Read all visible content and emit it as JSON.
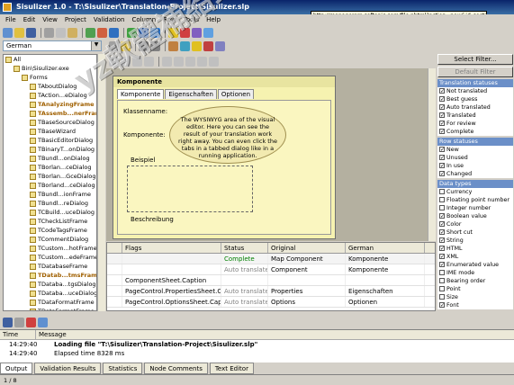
{
  "window": {
    "title": "Sisulizer 1.0 - T:\\Sisulizer\\Translation-Project\\Sisulizer.slp"
  },
  "tooltip": {
    "text": "http://managerem.softonic.com/file.phtml?action=new&id_section=724"
  },
  "menu": [
    "File",
    "Edit",
    "View",
    "Project",
    "Validation",
    "Column",
    "Row",
    "Tools",
    "Help"
  ],
  "language": {
    "selected": "German"
  },
  "tree": {
    "items": [
      {
        "label": "All",
        "bold": false,
        "level": 0
      },
      {
        "label": "Bin\\Sisulizer.exe",
        "bold": false,
        "level": 1
      },
      {
        "label": "Forms",
        "bold": false,
        "level": 2
      },
      {
        "label": "TAboutDialog",
        "bold": false,
        "level": 3
      },
      {
        "label": "TAction...eDialog",
        "bold": false,
        "level": 3
      },
      {
        "label": "TAnalyzingFrame",
        "bold": true,
        "level": 3
      },
      {
        "label": "TAssemb...nerFran",
        "bold": true,
        "level": 3
      },
      {
        "label": "TBaseSourceDialog",
        "bold": false,
        "level": 3
      },
      {
        "label": "TBaseWizard",
        "bold": false,
        "level": 3
      },
      {
        "label": "TBasicEditorDialog",
        "bold": false,
        "level": 3
      },
      {
        "label": "TBinaryT...onDialog",
        "bold": false,
        "level": 3
      },
      {
        "label": "TBundl...onDialog",
        "bold": false,
        "level": 3
      },
      {
        "label": "TBorlan...ceDialog",
        "bold": false,
        "level": 3
      },
      {
        "label": "TBorlan...GceDialog",
        "bold": false,
        "level": 3
      },
      {
        "label": "TBorland...ceDialog",
        "bold": false,
        "level": 3
      },
      {
        "label": "TBundl...ionFrame",
        "bold": false,
        "level": 3
      },
      {
        "label": "TBundl...reDialog",
        "bold": false,
        "level": 3
      },
      {
        "label": "TCBuild...uceDialog",
        "bold": false,
        "level": 3
      },
      {
        "label": "TCheckListFrame",
        "bold": false,
        "level": 3
      },
      {
        "label": "TCodeTagsFrame",
        "bold": false,
        "level": 3
      },
      {
        "label": "TCommentDialog",
        "bold": false,
        "level": 3
      },
      {
        "label": "TCustom...hotFrame",
        "bold": false,
        "level": 3
      },
      {
        "label": "TCustom...edeFrame",
        "bold": false,
        "level": 3
      },
      {
        "label": "TDatabaseFrame",
        "bold": false,
        "level": 3
      },
      {
        "label": "TDatab...tmsFrame",
        "bold": true,
        "level": 3
      },
      {
        "label": "TDataba...tgsDialog",
        "bold": false,
        "level": 3
      },
      {
        "label": "TDataba...uceDialog",
        "bold": false,
        "level": 3
      },
      {
        "label": "TDataFormatFrame",
        "bold": false,
        "level": 3
      },
      {
        "label": "TDataFormatFrame",
        "bold": false,
        "level": 3
      }
    ]
  },
  "dialog": {
    "title": "Komponente",
    "tabs": [
      "Komponente",
      "Eigenschaften",
      "Optionen"
    ],
    "labels": [
      "Klassenname:",
      "Komponente:",
      "Beispiel",
      "Beschreibung"
    ]
  },
  "balloon": {
    "text": "The WYSIWYG area of the visual editor. Here you can see the result of your translation work right away. You can even click the tabs in a tabbed dialog like in a running application."
  },
  "grid": {
    "headers": [
      "",
      "Flags",
      "Status",
      "Original",
      "German"
    ],
    "rows": [
      {
        "flag": "",
        "name": "",
        "status": "Complete",
        "original": "Map Component",
        "german": "Komponente"
      },
      {
        "flag": "",
        "name": "",
        "status": "Auto translated",
        "original": "Component",
        "german": "Komponente"
      },
      {
        "flag": "",
        "name": "ComponentSheet.Caption",
        "status": "",
        "original": "",
        "german": ""
      },
      {
        "flag": "",
        "name": "PageControl.PropertiesSheet.Caption",
        "status": "Auto translated",
        "original": "Properties",
        "german": "Eigenschaften"
      },
      {
        "flag": "",
        "name": "PageControl.OptionsSheet.Caption",
        "status": "Auto translated",
        "original": "Options",
        "german": "Optionen"
      }
    ]
  },
  "right": {
    "select_filter": "Select Filter...",
    "default_filter": "Default Filter",
    "groups": [
      {
        "title": "Translation statuses",
        "items": [
          {
            "label": "Not translated",
            "checked": true
          },
          {
            "label": "Best guess",
            "checked": true
          },
          {
            "label": "Auto translated",
            "checked": true
          },
          {
            "label": "Translated",
            "checked": true
          },
          {
            "label": "For review",
            "checked": true
          },
          {
            "label": "Complete",
            "checked": true
          }
        ]
      },
      {
        "title": "Row statuses",
        "items": [
          {
            "label": "New",
            "checked": true
          },
          {
            "label": "Unused",
            "checked": true
          },
          {
            "label": "In use",
            "checked": true
          },
          {
            "label": "Changed",
            "checked": true
          }
        ]
      },
      {
        "title": "Data types",
        "items": [
          {
            "label": "Currency",
            "checked": false
          },
          {
            "label": "Floating point number",
            "checked": false
          },
          {
            "label": "Integer number",
            "checked": false
          },
          {
            "label": "Boolean value",
            "checked": true
          },
          {
            "label": "Color",
            "checked": true
          },
          {
            "label": "Short cut",
            "checked": true
          },
          {
            "label": "String",
            "checked": true
          },
          {
            "label": "HTML",
            "checked": true
          },
          {
            "label": "XML",
            "checked": true
          },
          {
            "label": "Enumerated value",
            "checked": true
          },
          {
            "label": "IME mode",
            "checked": false
          },
          {
            "label": "Bearing order",
            "checked": false
          },
          {
            "label": "Point",
            "checked": false
          },
          {
            "label": "Size",
            "checked": false
          },
          {
            "label": "Font",
            "checked": true
          }
        ]
      }
    ]
  },
  "log": {
    "headers": [
      "Time",
      "Message"
    ],
    "rows": [
      {
        "time": "14:29:40",
        "message": "Loading file \"T:\\Sisulizer\\Translation-Project\\Sisulizer.slp\""
      },
      {
        "time": "14:29:40",
        "message": "Elapsed time 8328 ms"
      }
    ]
  },
  "bottom_tabs": [
    "Output",
    "Validation Results",
    "Statistics",
    "Node Comments",
    "Text Editor"
  ],
  "status": {
    "text": "1 / 8"
  },
  "watermark": {
    "text": "yz軟體補給站 http://31.to"
  }
}
